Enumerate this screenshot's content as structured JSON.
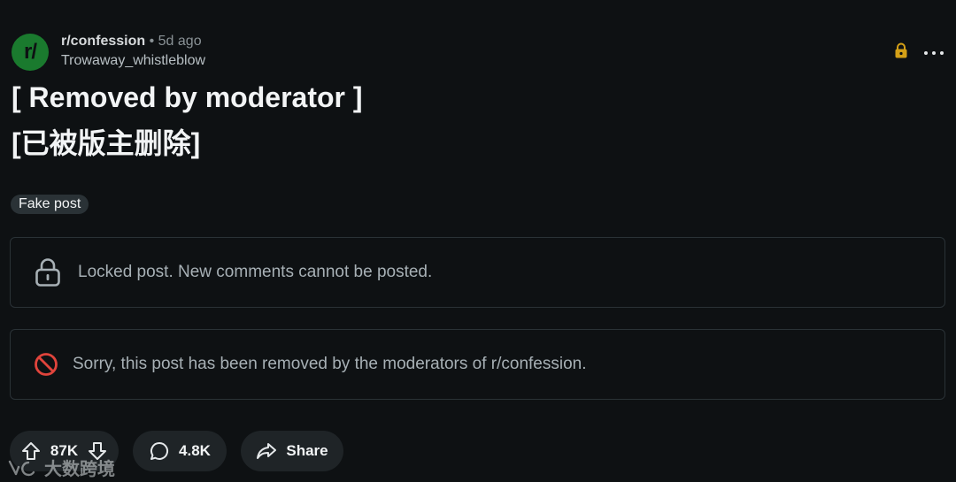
{
  "post": {
    "subreddit_avatar_text": "r/",
    "subreddit": "r/confession",
    "separator": "•",
    "age": "5d ago",
    "author": "Trowaway_whistleblow",
    "title_line1": "[ Removed by moderator ]",
    "title_line2": "[已被版主删除]",
    "flair": "Fake post"
  },
  "notices": {
    "locked": "Locked post. New comments cannot be posted.",
    "removed": "Sorry, this post has been removed by the moderators of r/confession."
  },
  "actions": {
    "vote_count": "87K",
    "comment_count": "4.8K",
    "share_label": "Share"
  },
  "watermark": "大数跨境",
  "icons": {
    "header_lock": "lock-icon",
    "more": "more-options-icon",
    "notice_lock": "lock-icon",
    "notice_removed": "prohibited-icon",
    "upvote": "upvote-icon",
    "downvote": "downvote-icon",
    "comment": "comment-icon",
    "share": "share-icon"
  },
  "colors": {
    "background": "#0e1113",
    "avatar": "#1a7a2e",
    "lock_accent": "#d4a017",
    "removed_accent": "#e0443c",
    "pill_bg": "#1f2427"
  }
}
